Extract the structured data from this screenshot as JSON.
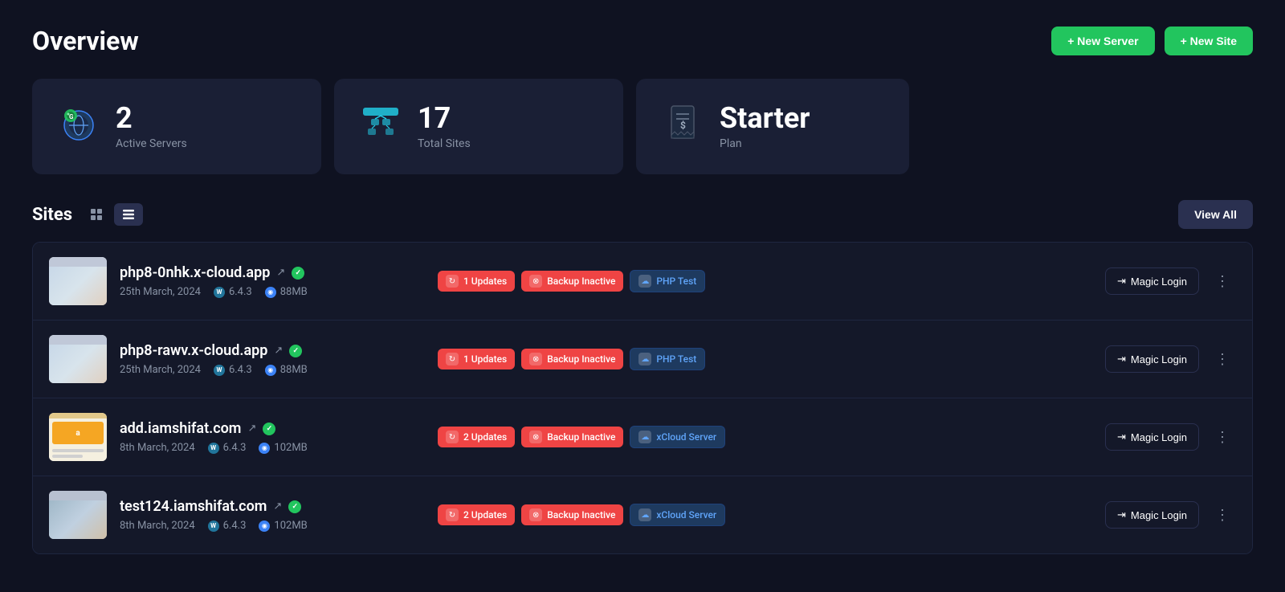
{
  "page": {
    "title": "Overview"
  },
  "header": {
    "new_server_label": "+ New Server",
    "new_site_label": "+ New Site"
  },
  "stats": [
    {
      "id": "active-servers",
      "number": "2",
      "label": "Active Servers",
      "icon": "globe"
    },
    {
      "id": "total-sites",
      "number": "17",
      "label": "Total Sites",
      "icon": "network"
    },
    {
      "id": "plan",
      "number": "Starter",
      "label": "Plan",
      "icon": "receipt"
    }
  ],
  "sites_section": {
    "title": "Sites",
    "view_all_label": "View All"
  },
  "sites": [
    {
      "id": "site-1",
      "name": "php8-0nhk.x-cloud.app",
      "date": "25th March, 2024",
      "wp_version": "6.4.3",
      "disk": "88MB",
      "thumb_type": "photo",
      "tags": [
        {
          "label": "1 Updates",
          "type": "updates"
        },
        {
          "label": "Backup Inactive",
          "type": "backup"
        },
        {
          "label": "PHP Test",
          "type": "info"
        }
      ],
      "magic_login_label": "Magic Login"
    },
    {
      "id": "site-2",
      "name": "php8-rawv.x-cloud.app",
      "date": "25th March, 2024",
      "wp_version": "6.4.3",
      "disk": "88MB",
      "thumb_type": "photo",
      "tags": [
        {
          "label": "1 Updates",
          "type": "updates"
        },
        {
          "label": "Backup Inactive",
          "type": "backup"
        },
        {
          "label": "PHP Test",
          "type": "info"
        }
      ],
      "magic_login_label": "Magic Login"
    },
    {
      "id": "site-3",
      "name": "add.iamshifat.com",
      "date": "8th March, 2024",
      "wp_version": "6.4.3",
      "disk": "102MB",
      "thumb_type": "yellow",
      "tags": [
        {
          "label": "2 Updates",
          "type": "updates"
        },
        {
          "label": "Backup Inactive",
          "type": "backup"
        },
        {
          "label": "xCloud Server",
          "type": "info"
        }
      ],
      "magic_login_label": "Magic Login"
    },
    {
      "id": "site-4",
      "name": "test124.iamshifat.com",
      "date": "8th March, 2024",
      "wp_version": "6.4.3",
      "disk": "102MB",
      "thumb_type": "photo2",
      "tags": [
        {
          "label": "2 Updates",
          "type": "updates"
        },
        {
          "label": "Backup Inactive",
          "type": "backup"
        },
        {
          "label": "xCloud Server",
          "type": "info"
        }
      ],
      "magic_login_label": "Magic Login"
    }
  ]
}
